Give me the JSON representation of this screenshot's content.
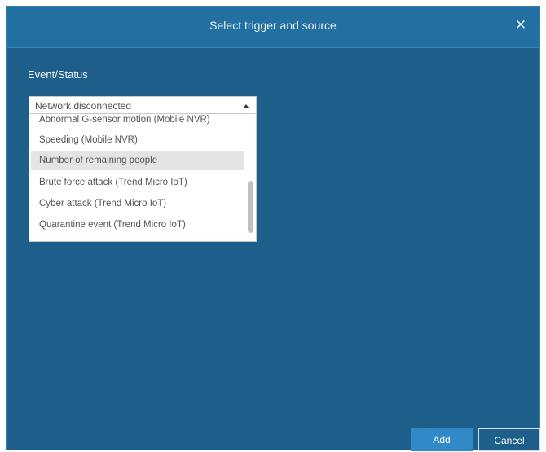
{
  "dialog": {
    "title": "Select trigger and source",
    "close_glyph": "✕",
    "close_icon": "close-icon"
  },
  "event_status": {
    "label": "Event/Status",
    "selected_value": "Network disconnected",
    "options": [
      "Abnormal G-sensor motion (Mobile NVR)",
      "Speeding (Mobile NVR)",
      "Number of remaining people",
      "Brute force attack (Trend Micro IoT)",
      "Cyber attack (Trend Micro IoT)",
      "Quarantine event (Trend Micro IoT)"
    ],
    "highlighted_option": "Number of remaining people"
  },
  "footer": {
    "add_label": "Add",
    "cancel_label": "Cancel"
  },
  "colors": {
    "dialog_bg": "#1d5f8a",
    "titlebar_bg": "#2270a1",
    "primary_button": "#3189c8"
  }
}
